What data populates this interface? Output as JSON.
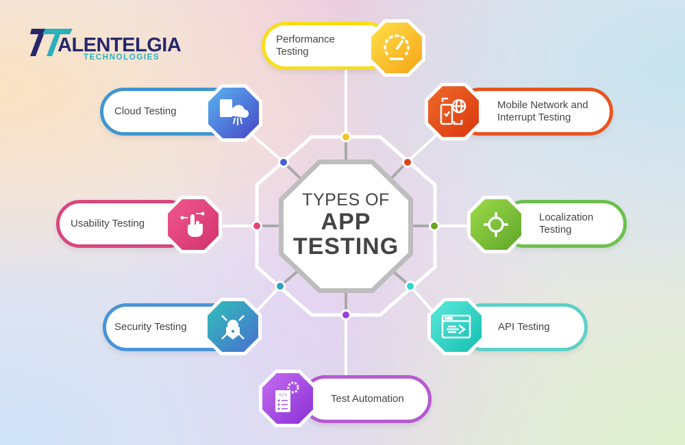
{
  "logo": {
    "brand": "ALENTELGIA",
    "mark": "T",
    "subtitle": "TECHNOLOGIES"
  },
  "center": {
    "line1": "TYPES OF",
    "line2": "APP",
    "line3": "TESTING"
  },
  "colors": {
    "frame": "#ffffff",
    "connector": "#9a9a9a",
    "text": "#444444"
  },
  "items": [
    {
      "id": "performance",
      "label": "Performance\nTesting",
      "icon": "speedometer-icon",
      "color": "#f9c02a",
      "border": "#f7de1a"
    },
    {
      "id": "mobile-network",
      "label": "Mobile Network and\nInterrupt Testing",
      "icon": "mobile-globe-icon",
      "color": "#e8531f",
      "border": "#e8531f"
    },
    {
      "id": "localization",
      "label": "Localization\nTesting",
      "icon": "crosshair-icon",
      "color": "#7cc23a",
      "border": "#6cc14e"
    },
    {
      "id": "api",
      "label": "API Testing",
      "icon": "api-window-icon",
      "color": "#2fd4c4",
      "border": "#5dd0c8"
    },
    {
      "id": "test-automation",
      "label": "Test Automation",
      "icon": "code-gear-document-icon",
      "color": "#a24ee3",
      "border": "#b65ad0"
    },
    {
      "id": "security",
      "label": "Security Testing",
      "icon": "lock-shield-icon",
      "color": "#3a8fc0",
      "border": "#4a93d6"
    },
    {
      "id": "usability",
      "label": "Usability Testing",
      "icon": "hand-tap-icon",
      "color": "#e5427a",
      "border": "#d9457e"
    },
    {
      "id": "cloud",
      "label": "Cloud Testing",
      "icon": "cloud-clipboard-icon",
      "color": "#4a6fd8",
      "border": "#3f95d2"
    }
  ]
}
